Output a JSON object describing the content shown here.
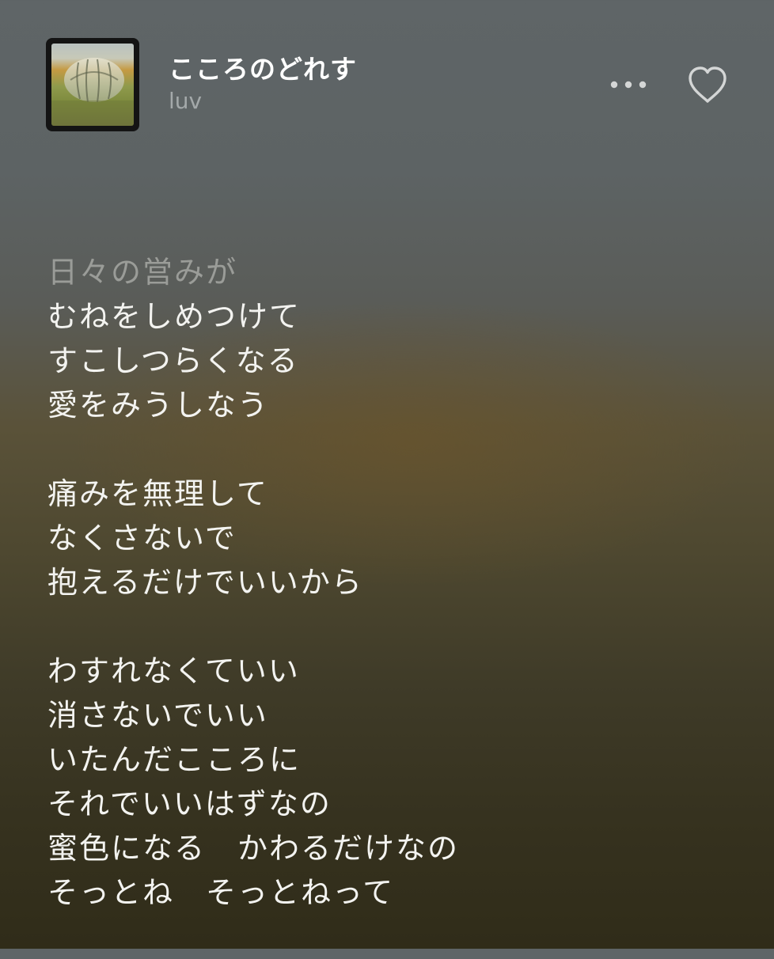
{
  "now_playing": {
    "title": "こころのどれす",
    "artist": "luv"
  },
  "icons": {
    "more": "ellipsis-icon",
    "like": "heart-outline-icon"
  },
  "colors": {
    "title": "#ffffff",
    "artist": "#a4a9aa",
    "lyric_active": "#f3f3f0",
    "lyric_dim": "#9a9c98",
    "icon": "#d4d6d6"
  },
  "lyrics": {
    "stanzas": [
      [
        "日々の営みが",
        "むねをしめつけて",
        "すこしつらくなる",
        "愛をみうしなう"
      ],
      [
        "痛みを無理して",
        "なくさないで",
        "抱えるだけでいいから"
      ],
      [
        "わすれなくていい",
        "消さないでいい",
        "いたんだこころに",
        "それでいいはずなの",
        "蜜色になる　かわるだけなの",
        "そっとね　そっとねって"
      ]
    ]
  }
}
